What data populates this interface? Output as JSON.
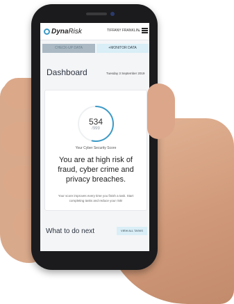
{
  "app": {
    "brand_bold": "Dyna",
    "brand_light": "Risk"
  },
  "header": {
    "user_name": "TIFFANY FRANKLIN",
    "chevron": "⌄"
  },
  "tabs": [
    {
      "label": "CHECK-UP DATA",
      "active": true
    },
    {
      "label": "+MONITOR DATA",
      "active": false
    }
  ],
  "dashboard": {
    "title": "Dashboard",
    "date": "Tuesday 3 September 2019"
  },
  "score_card": {
    "score": "534",
    "max": "/999",
    "fraction": 0.534,
    "label": "Your Cyber Security Score",
    "risk_message": "You are at high risk of fraud, cyber crime and privacy breaches.",
    "hint": "Your score improves every time you finish a task. Start completing tasks and reduce your risk!"
  },
  "todo": {
    "title": "What to do next",
    "view_all": "VIEW ALL TASKS"
  },
  "colors": {
    "accent": "#3c9ac7",
    "tab_inactive": "#aab9c4",
    "tab_light": "#d9eef6"
  }
}
